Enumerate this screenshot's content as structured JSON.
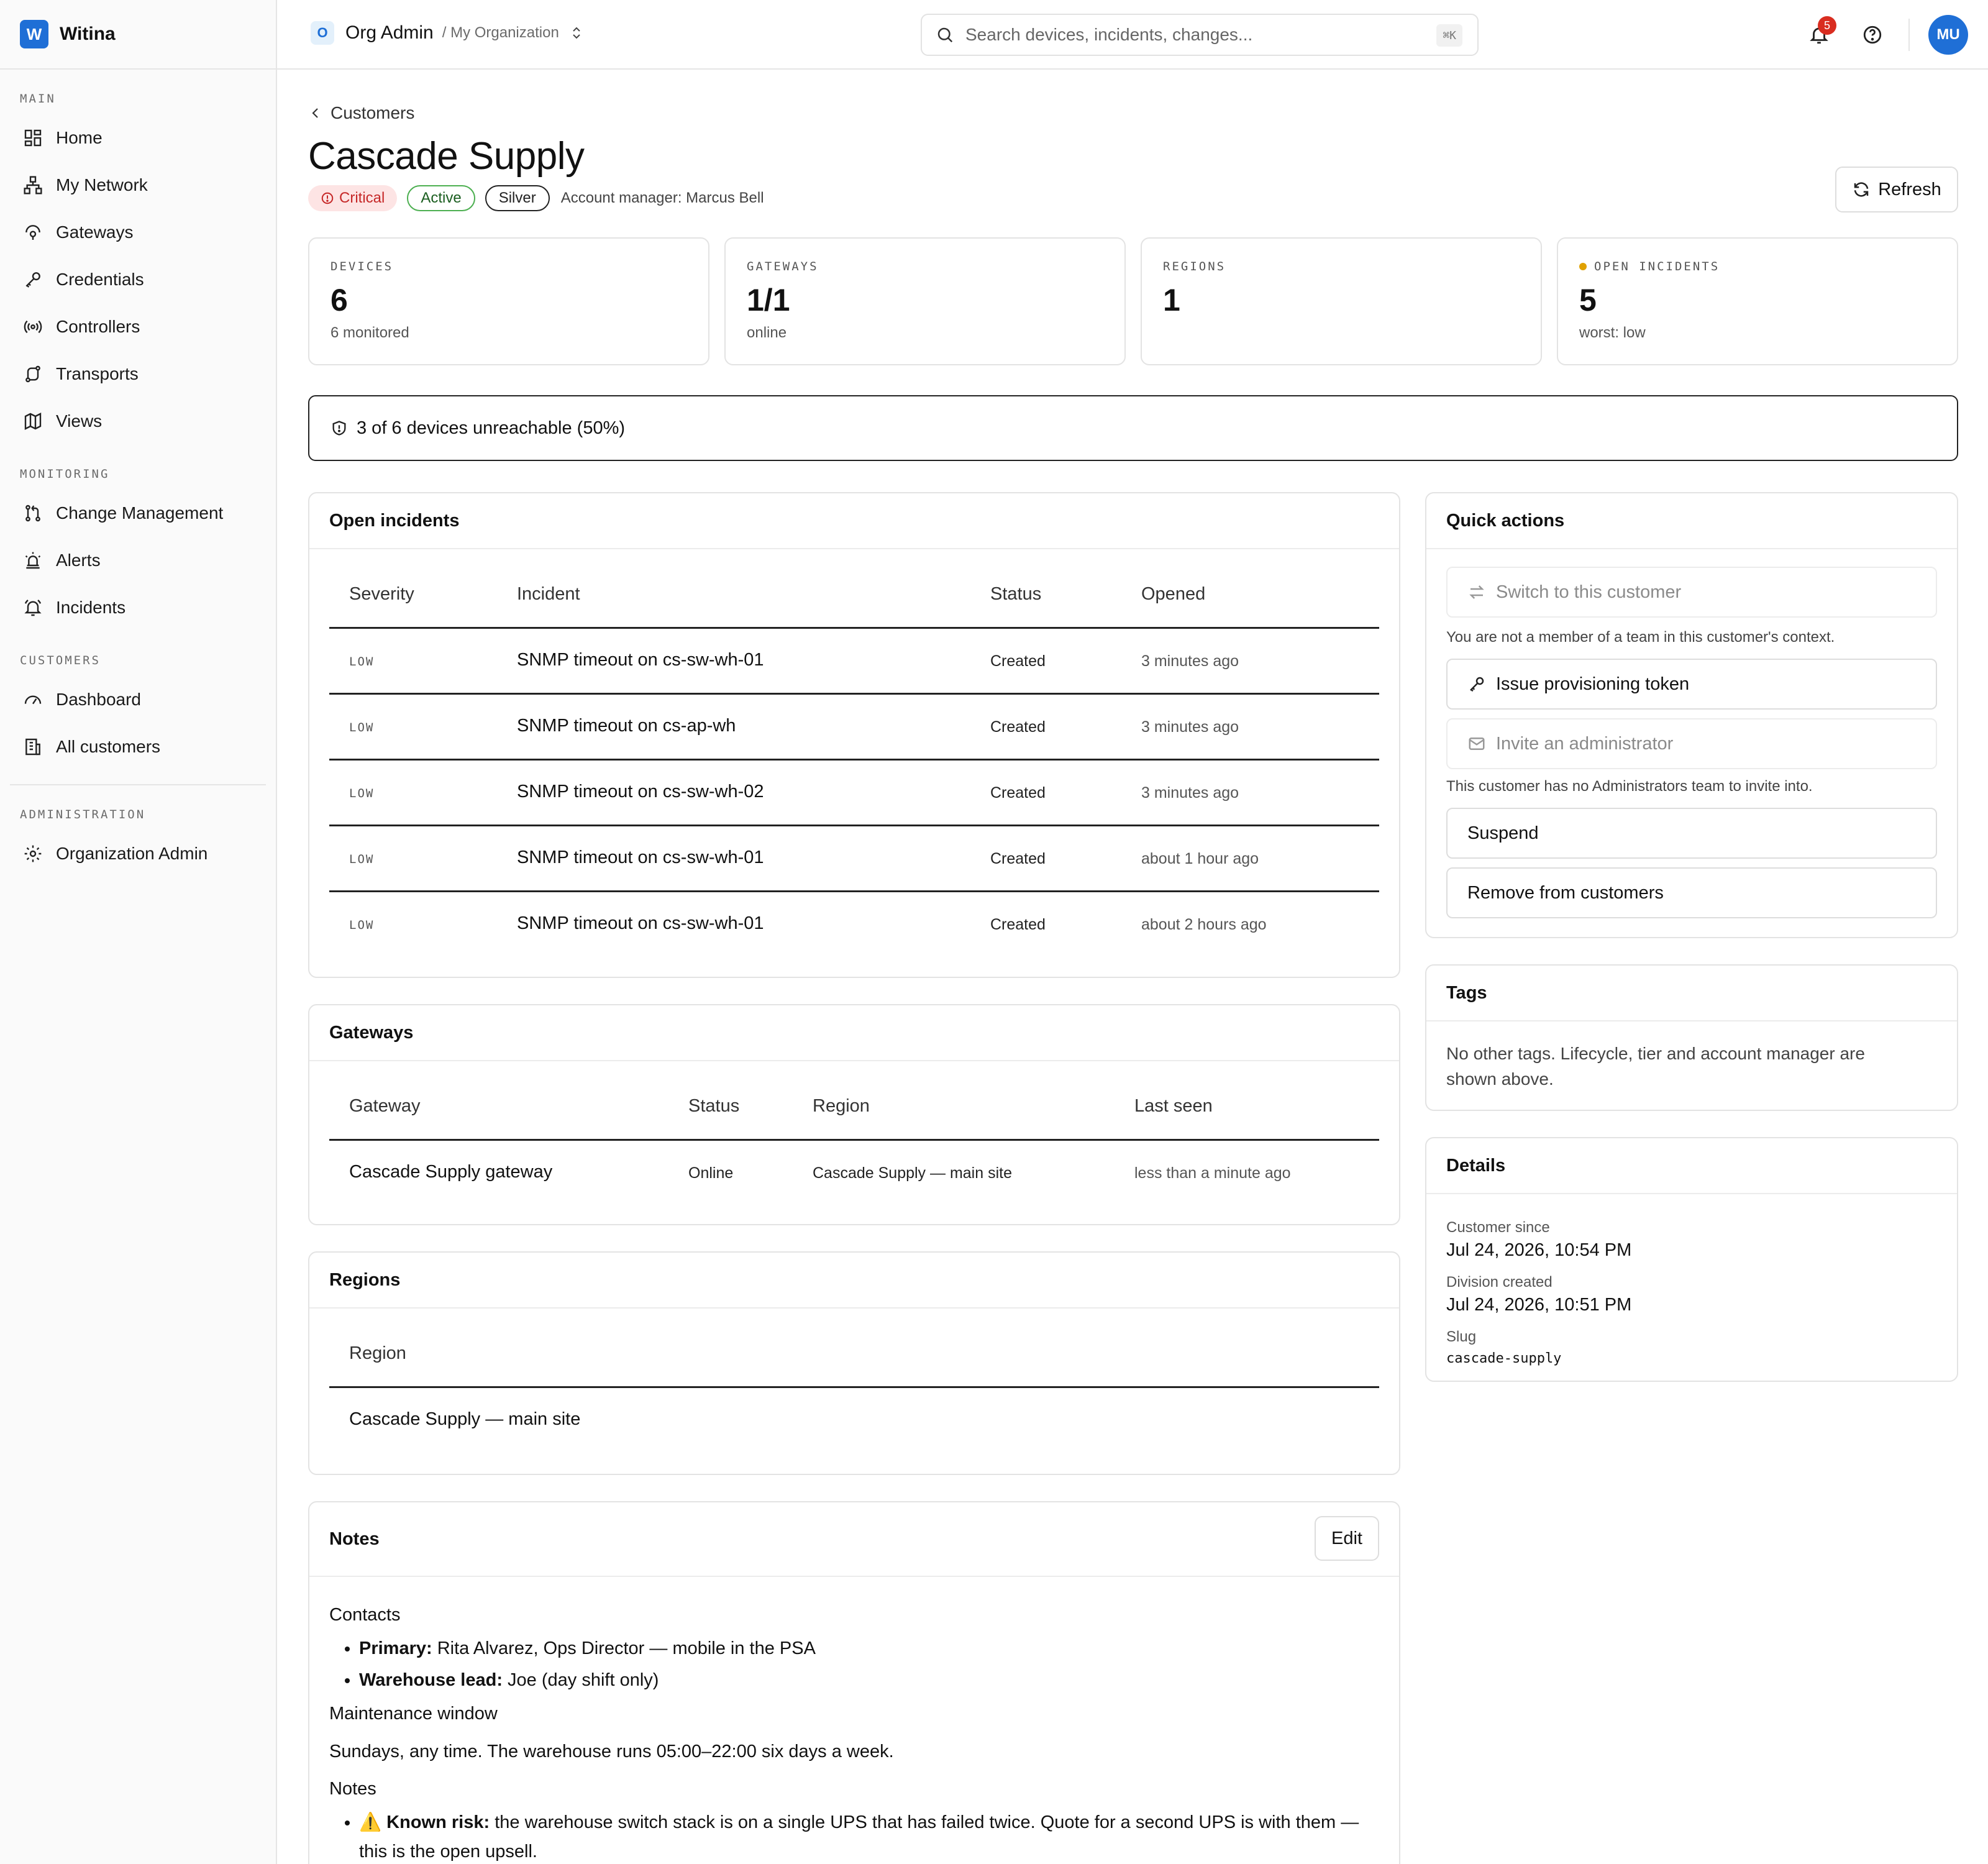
{
  "brand": {
    "logo_letter": "W",
    "name": "Witina"
  },
  "sidebar": {
    "sections": [
      {
        "title": "MAIN",
        "items": [
          {
            "label": "Home",
            "icon": "grid-icon"
          },
          {
            "label": "My Network",
            "icon": "network-icon"
          },
          {
            "label": "Gateways",
            "icon": "gateway-icon"
          },
          {
            "label": "Credentials",
            "icon": "key-icon"
          },
          {
            "label": "Controllers",
            "icon": "broadcast-icon"
          },
          {
            "label": "Transports",
            "icon": "route-icon"
          },
          {
            "label": "Views",
            "icon": "map-icon"
          }
        ]
      },
      {
        "title": "MONITORING",
        "items": [
          {
            "label": "Change Management",
            "icon": "git-pull-request-icon"
          },
          {
            "label": "Alerts",
            "icon": "siren-icon"
          },
          {
            "label": "Incidents",
            "icon": "bell-ring-icon"
          }
        ]
      },
      {
        "title": "CUSTOMERS",
        "items": [
          {
            "label": "Dashboard",
            "icon": "gauge-icon"
          },
          {
            "label": "All customers",
            "icon": "building-icon"
          }
        ]
      },
      {
        "title": "ADMINISTRATION",
        "items": [
          {
            "label": "Organization Admin",
            "icon": "gear-icon"
          }
        ]
      }
    ]
  },
  "header": {
    "org_badge": "O",
    "org_name": "Org Admin",
    "org_sub": "/ My Organization",
    "search_placeholder": "Search devices, incidents, changes...",
    "search_shortcut": "⌘K",
    "notification_count": "5",
    "avatar_initials": "MU"
  },
  "page": {
    "breadcrumb": "Customers",
    "title": "Cascade Supply",
    "badges": {
      "critical": "Critical",
      "active": "Active",
      "tier": "Silver"
    },
    "account_manager": "Account manager: Marcus Bell",
    "refresh_label": "Refresh"
  },
  "stats": [
    {
      "label": "DEVICES",
      "value": "6",
      "sub": "6 monitored",
      "dot": false
    },
    {
      "label": "GATEWAYS",
      "value": "1/1",
      "sub": "online",
      "dot": false
    },
    {
      "label": "REGIONS",
      "value": "1",
      "sub": "",
      "dot": false
    },
    {
      "label": "OPEN INCIDENTS",
      "value": "5",
      "sub": "worst: low",
      "dot": true
    }
  ],
  "alert": {
    "text": "3 of 6 devices unreachable (50%)"
  },
  "incidents": {
    "title": "Open incidents",
    "columns": [
      "Severity",
      "Incident",
      "Status",
      "Opened"
    ],
    "rows": [
      {
        "severity": "LOW",
        "incident": "SNMP timeout on cs-sw-wh-01",
        "status": "Created",
        "opened": "3 minutes ago"
      },
      {
        "severity": "LOW",
        "incident": "SNMP timeout on cs-ap-wh",
        "status": "Created",
        "opened": "3 minutes ago"
      },
      {
        "severity": "LOW",
        "incident": "SNMP timeout on cs-sw-wh-02",
        "status": "Created",
        "opened": "3 minutes ago"
      },
      {
        "severity": "LOW",
        "incident": "SNMP timeout on cs-sw-wh-01",
        "status": "Created",
        "opened": "about 1 hour ago"
      },
      {
        "severity": "LOW",
        "incident": "SNMP timeout on cs-sw-wh-01",
        "status": "Created",
        "opened": "about 2 hours ago"
      }
    ]
  },
  "gateways": {
    "title": "Gateways",
    "columns": [
      "Gateway",
      "Status",
      "Region",
      "Last seen"
    ],
    "rows": [
      {
        "gateway": "Cascade Supply gateway",
        "status": "Online",
        "region": "Cascade Supply — main site",
        "last_seen": "less than a minute ago"
      }
    ]
  },
  "regions": {
    "title": "Regions",
    "columns": [
      "Region"
    ],
    "rows": [
      {
        "region": "Cascade Supply — main site"
      }
    ]
  },
  "notes": {
    "title": "Notes",
    "edit_label": "Edit",
    "contacts_heading": "Contacts",
    "primary_label": "Primary:",
    "primary_text": "Rita Alvarez, Ops Director — mobile in the PSA",
    "lead_label": "Warehouse lead:",
    "lead_text": "Joe (day shift only)",
    "maintenance_heading": "Maintenance window",
    "maintenance_text": "Sundays, any time. The warehouse runs 05:00–22:00 six days a week.",
    "notes_heading": "Notes",
    "risk_emoji": "⚠️",
    "risk_label": "Known risk:",
    "risk_text": "the warehouse switch stack is on a single UPS that has failed twice. Quote for a second UPS is with them — this is the open upsell."
  },
  "quick_actions": {
    "title": "Quick actions",
    "switch_label": "Switch to this customer",
    "switch_note": "You are not a member of a team in this customer's context.",
    "token_label": "Issue provisioning token",
    "invite_label": "Invite an administrator",
    "invite_note": "This customer has no Administrators team to invite into.",
    "suspend_label": "Suspend",
    "remove_label": "Remove from customers"
  },
  "tags": {
    "title": "Tags",
    "text": "No other tags. Lifecycle, tier and account manager are shown above."
  },
  "details": {
    "title": "Details",
    "customer_since_label": "Customer since",
    "customer_since": "Jul 24, 2026, 10:54 PM",
    "division_created_label": "Division created",
    "division_created": "Jul 24, 2026, 10:51 PM",
    "slug_label": "Slug",
    "slug": "cascade-supply"
  }
}
